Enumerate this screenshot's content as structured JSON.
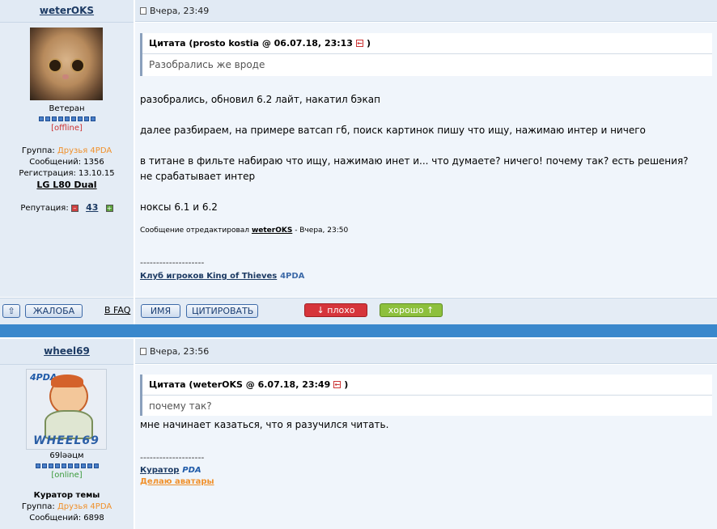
{
  "post1": {
    "username": "weterOKS",
    "date": "Вчера, 23:49",
    "rank": "Ветеран",
    "status": "[offline]",
    "group_label": "Группа:",
    "group_value": "Друзья 4PDA",
    "messages": "Сообщений: 1356",
    "registration": "Регистрация: 13.10.15",
    "device": "LG L80 Dual",
    "reputation_label": "Репутация:",
    "reputation_value": "43",
    "quote_header": "Цитата (prosto kostia @ 06.07.18, 23:13",
    "quote_body": "Разобрались же вроде",
    "paragraphs": [
      "разобрались, обновил 6.2 лайт, накатил бэкап",
      "далее разбираем, на примере ватсап гб, поиск картинок пишу что ищу, нажимаю интер и ничего",
      "в титане в фильте набираю что ищу, нажимаю инет и... что думаете? ничего! почему так? есть решения?",
      "не срабатывает интер",
      "ноксы 6.1 и 6.2"
    ],
    "edit_note_prefix": "Сообщение отредактировал",
    "edit_note_user": "weterOKS",
    "edit_note_time": "- Вчера, 23:50",
    "sig_dashes": "--------------------",
    "sig_link": "Клуб игроков King of Thieves",
    "sig_4pda": "4PDA"
  },
  "actions": {
    "complaint": "ЖАЛОБА",
    "faq": "В FAQ",
    "name": "ИМЯ",
    "quote": "ЦИТИРОВАТЬ",
    "bad": "плохо",
    "good": "хорошо"
  },
  "post2": {
    "username": "wheel69",
    "date": "Вчера, 23:56",
    "avatar_brand": "4PDA",
    "avatar_text": "WHEEL69",
    "rank": "69lәәцм",
    "status": "[online]",
    "role": "Куратор темы",
    "group_label": "Группа:",
    "group_value": "Друзья 4PDA",
    "messages": "Сообщений: 6898",
    "quote_header": "Цитата (weterOKS @ 6.07.18, 23:49",
    "quote_body": "почему так?",
    "paragraph": "мне начинает казаться, что я разучился читать.",
    "sig_dashes": "--------------------",
    "sig_curator": "Куратор",
    "sig_curator_logo": "PDA",
    "sig_avatars": "Делаю аватары"
  },
  "colors": {
    "link": "#1c3a63",
    "accent_bar": "#3a88cc",
    "orange": "#f0902a",
    "offline": "#cc3333",
    "online": "#3a9a3a"
  }
}
